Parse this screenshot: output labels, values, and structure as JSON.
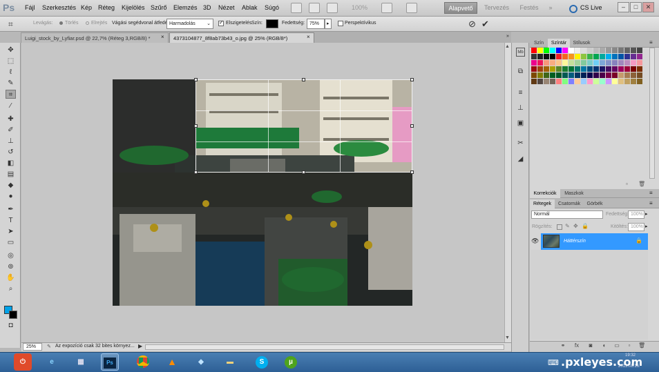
{
  "app": {
    "logo": "Ps",
    "menu": [
      "Fájl",
      "Szerkesztés",
      "Kép",
      "Réteg",
      "Kijelölés",
      "Szűrő",
      "Elemzés",
      "3D",
      "Nézet",
      "Ablak",
      "Súgó"
    ],
    "zoom_display": "100%",
    "workspaces": {
      "active": "Alapvető",
      "design": "Tervezés",
      "paint": "Festés",
      "more": "»"
    },
    "cs_live": "CS Live",
    "window_controls": {
      "minimize": "–",
      "restore": "□",
      "close": "✕"
    }
  },
  "options_bar": {
    "crop_label": "Levágás:",
    "delete_label": "Törlés",
    "hide_label": "Elrejtés",
    "guide_overlay_label": "Vágási segédvonal átfedése:",
    "guide_overlay_value": "Harmadolás",
    "shield_label": "Elszigetelés",
    "color_label": "Szín:",
    "color_value": "#000000",
    "opacity_label": "Fedettség:",
    "opacity_value": "75%",
    "perspective_label": "Perspektívikus",
    "cancel_symbol": "⊘",
    "commit_symbol": "✔"
  },
  "documents": {
    "tabs": [
      {
        "title": "Luigi_stock_by_Lyfiar.psd @ 22,7% (Réteg 3,RGB/8) *",
        "close": "×"
      },
      {
        "title": "4373104877_8f8ab73b43_o.jpg @ 25% (RGB/8*)",
        "close": "×"
      }
    ]
  },
  "status": {
    "zoom": "25%",
    "message": "Az expozíció csak 32 bites környez...",
    "arrow": "▶"
  },
  "swatches_panel": {
    "tabs": [
      "Szín",
      "Színtár",
      "Stílusok"
    ],
    "active_tab": "Színtár",
    "colors": [
      "#ff0000",
      "#ffff00",
      "#00ff00",
      "#00ffff",
      "#0000ff",
      "#ff00ff",
      "#ffffff",
      "#eeeeee",
      "#dddddd",
      "#cccccc",
      "#bbbbbb",
      "#aaaaaa",
      "#999999",
      "#888888",
      "#777777",
      "#666666",
      "#555555",
      "#444444",
      "#333333",
      "#222222",
      "#111111",
      "#000000",
      "#ee1d24",
      "#f26522",
      "#f7941d",
      "#fff200",
      "#8dc63f",
      "#39b54a",
      "#00a651",
      "#00a99d",
      "#00aeef",
      "#0072bc",
      "#0054a6",
      "#2e3192",
      "#662d91",
      "#92278f",
      "#ec008c",
      "#ed145b",
      "#f7977a",
      "#f9ad81",
      "#fdc68a",
      "#fff79a",
      "#c4df9b",
      "#a3d39c",
      "#82ca9d",
      "#7bcdc8",
      "#6ecff6",
      "#7ea7d8",
      "#8493ca",
      "#8882be",
      "#a187be",
      "#bc8cbf",
      "#f49ac2",
      "#f6989d",
      "#9e0b0f",
      "#a0410d",
      "#a36209",
      "#aba000",
      "#598527",
      "#1a7b30",
      "#007236",
      "#00746b",
      "#0076a3",
      "#004b80",
      "#003471",
      "#1b1464",
      "#440e62",
      "#630460",
      "#9e005d",
      "#9e0039",
      "#790000",
      "#7b2e00",
      "#7d4900",
      "#827b00",
      "#406618",
      "#005e20",
      "#005826",
      "#005952",
      "#005b7f",
      "#003663",
      "#002157",
      "#0d004c",
      "#32004b",
      "#4b0049",
      "#7b0046",
      "#7a0026",
      "#c69c6d",
      "#a67c52",
      "#8c6239",
      "#754c24",
      "#603913",
      "#534741",
      "#998675",
      "#736357",
      "#ff8080",
      "#80ff80",
      "#8080ff",
      "#ffcc99",
      "#99ccff",
      "#ff99cc",
      "#ccff99",
      "#99ffcc",
      "#cc99ff",
      "#ffff99",
      "#e0c080",
      "#c0a060",
      "#a08040",
      "#806020"
    ]
  },
  "adjustments_panel": {
    "tabs": [
      "Korrekciók",
      "Maszkok"
    ]
  },
  "layers_panel": {
    "tabs": [
      "Rétegek",
      "Csatornák",
      "Görbék"
    ],
    "blend_mode": "Normál",
    "opacity_label": "Fedettség:",
    "opacity_value": "100%",
    "lock_label": "Rögzítés:",
    "fill_label": "Kitöltés:",
    "fill_value": "100%",
    "layers": [
      {
        "name": "Háttérszín",
        "visible": true,
        "locked": true
      }
    ]
  },
  "taskbar": {
    "apps": [
      "shutdown",
      "internet-explorer",
      "calculator",
      "photoshop",
      "chrome",
      "vlc",
      "notepad",
      "file-explorer",
      "skype",
      "utorrent"
    ],
    "active_app": "photoshop",
    "clock_time": "19:32",
    "clock_date": "2013.08.16."
  },
  "watermark": ".pxleyes.com"
}
